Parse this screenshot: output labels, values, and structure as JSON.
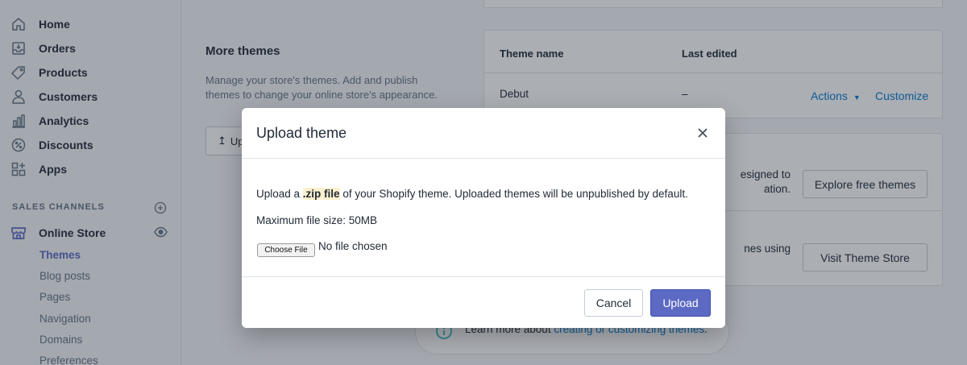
{
  "sidebar": {
    "items": [
      {
        "label": "Home",
        "icon": "home-icon"
      },
      {
        "label": "Orders",
        "icon": "orders-icon"
      },
      {
        "label": "Products",
        "icon": "tag-icon"
      },
      {
        "label": "Customers",
        "icon": "person-icon"
      },
      {
        "label": "Analytics",
        "icon": "bar-chart-icon"
      },
      {
        "label": "Discounts",
        "icon": "discount-icon"
      },
      {
        "label": "Apps",
        "icon": "apps-icon"
      }
    ],
    "sales_channels_label": "SALES CHANNELS",
    "online_store": {
      "label": "Online Store",
      "icon": "store-icon"
    },
    "sub_items": [
      {
        "label": "Themes",
        "active": true
      },
      {
        "label": "Blog posts"
      },
      {
        "label": "Pages"
      },
      {
        "label": "Navigation"
      },
      {
        "label": "Domains"
      },
      {
        "label": "Preferences"
      }
    ]
  },
  "main": {
    "more_themes": {
      "title": "More themes",
      "description": "Manage your store's themes. Add and publish themes to change your online store's appearance.",
      "upload_button": "Up"
    },
    "themes_table": {
      "col_name": "Theme name",
      "col_edited": "Last edited",
      "row": {
        "name": "Debut",
        "edited": "–",
        "actions": "Actions",
        "customize": "Customize"
      }
    },
    "free_themes": {
      "text": "esigned to\nation.",
      "button": "Explore free themes"
    },
    "theme_store": {
      "text": "nes using",
      "button": "Visit Theme Store"
    },
    "learn_more": {
      "prefix": "Learn more about ",
      "link": "creating or customizing themes",
      "suffix": "."
    }
  },
  "modal": {
    "title": "Upload theme",
    "line1_pre": "Upload a ",
    "line1_highlight": ".zip file",
    "line1_post": " of your Shopify theme. Uploaded themes will be unpublished by default.",
    "max_size": "Maximum file size: 50MB",
    "choose_file": "Choose File",
    "no_file": "No file chosen",
    "cancel": "Cancel",
    "upload": "Upload"
  },
  "colors": {
    "primary": "#5c6ac4",
    "link": "#007ace",
    "highlight": "#fcf1cd"
  }
}
